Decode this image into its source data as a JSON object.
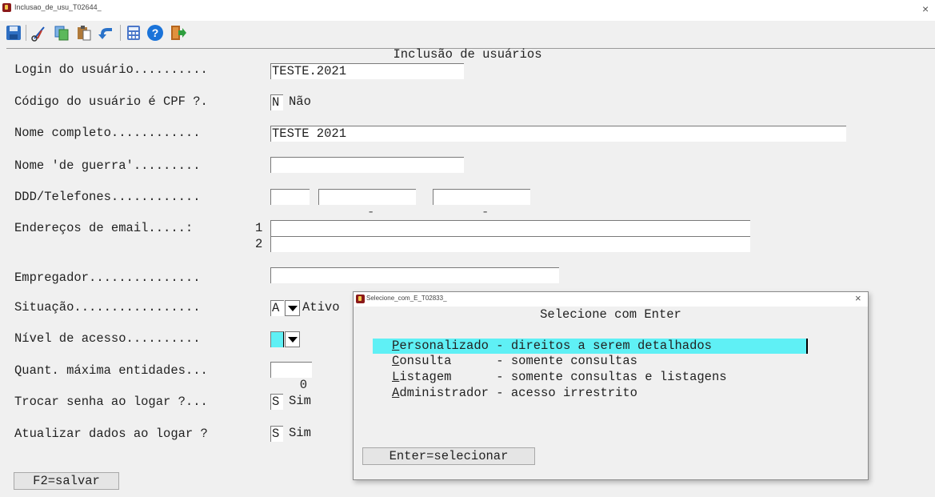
{
  "window": {
    "title": "Inclusao_de_usu_T02644_",
    "close": "×"
  },
  "toolbar": {
    "icons": [
      "save-icon",
      "cut-icon",
      "copy-icon",
      "paste-icon",
      "undo-icon",
      "calculator-icon",
      "help-icon",
      "exit-icon"
    ],
    "colors": {
      "save": "#2f6fc2",
      "help": "#1a73d9",
      "exit": "#d97a14"
    }
  },
  "form": {
    "title": "Inclusão de usuários",
    "login": {
      "label": "Login do usuário.......... ",
      "value": "TESTE.2021"
    },
    "cpf": {
      "label": "Código do usuário é CPF ?. ",
      "value": "N",
      "text": "Não"
    },
    "nome": {
      "label": "Nome completo............ ",
      "value": "TESTE 2021"
    },
    "guerra": {
      "label": "Nome 'de guerra'......... ",
      "value": ""
    },
    "telefones": {
      "label": "DDD/Telefones............ ",
      "ddd": "",
      "tel1": "-",
      "tel2": "-"
    },
    "email": {
      "label": "Endereços de email.....: ",
      "n1": "1",
      "n2": "2",
      "v1": "",
      "v2": ""
    },
    "empregador": {
      "label": "Empregador............... ",
      "value": ""
    },
    "situacao": {
      "label": "Situação................. ",
      "value": "A",
      "text": "Ativo"
    },
    "nivel": {
      "label": "Nível de acesso.......... ",
      "value": ""
    },
    "quant": {
      "label": "Quant. máxima entidades... ",
      "value": "0"
    },
    "trocar": {
      "label": "Trocar senha ao logar ?... ",
      "value": "S",
      "text": "Sim"
    },
    "atualizar": {
      "label": "Atualizar dados ao logar ? ",
      "value": "S",
      "text": "Sim"
    },
    "save_button": "F2=salvar"
  },
  "dialog": {
    "title": "Selecione_com_E_T02833_",
    "close": "×",
    "heading": "Selecione com Enter",
    "options": [
      {
        "key": "P",
        "rest": "ersonalizado - direitos a serem detalhados",
        "selected": true
      },
      {
        "key": "C",
        "rest": "onsulta      - somente consultas",
        "selected": false
      },
      {
        "key": "L",
        "rest": "istagem      - somente consultas e listagens",
        "selected": false
      },
      {
        "key": "A",
        "rest": "dministrador - acesso irrestrito",
        "selected": false
      }
    ],
    "button": "Enter=selecionar",
    "highlight_color": "#5ff0f5"
  }
}
